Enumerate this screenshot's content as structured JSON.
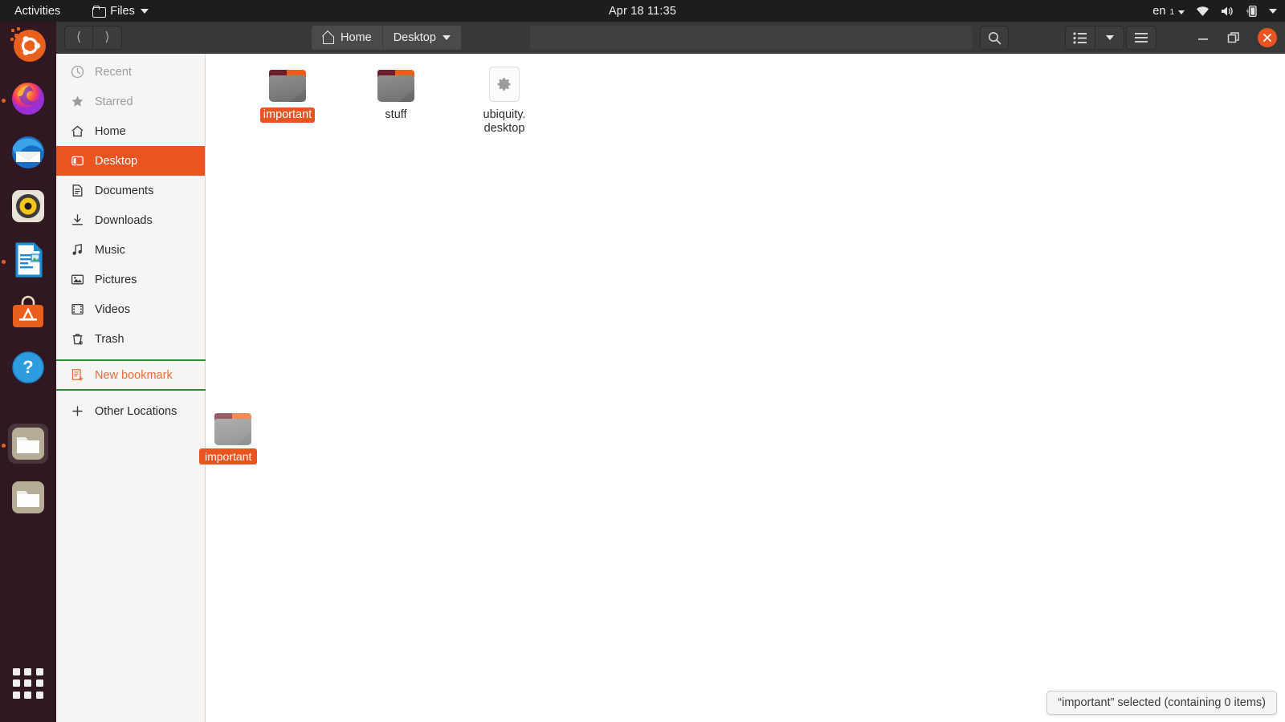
{
  "topbar": {
    "activities": "Activities",
    "app_name": "Files",
    "app_icon": "folder-icon",
    "app_caret_icon": "chevron-down-icon",
    "clock": "Apr 18  11:35",
    "language": "en",
    "language_sub": "1",
    "lang_caret_icon": "chevron-down-icon",
    "wifi_icon": "wifi-icon",
    "volume_icon": "volume-icon",
    "battery_icon": "battery-charging-icon",
    "system_caret_icon": "chevron-down-icon"
  },
  "dock": {
    "items": [
      {
        "name": "ubuntu-logo",
        "label": "Ubuntu",
        "running": false,
        "active": false
      },
      {
        "name": "firefox",
        "label": "Firefox",
        "running": true,
        "active": false
      },
      {
        "name": "thunderbird",
        "label": "Thunderbird Mail",
        "running": false,
        "active": false
      },
      {
        "name": "rhythmbox",
        "label": "Rhythmbox",
        "running": false,
        "active": false
      },
      {
        "name": "libreoffice-writer",
        "label": "LibreOffice Writer",
        "running": true,
        "active": false
      },
      {
        "name": "ubuntu-software",
        "label": "Ubuntu Software",
        "running": false,
        "active": false
      },
      {
        "name": "help",
        "label": "Help",
        "running": false,
        "active": false
      },
      {
        "name": "files",
        "label": "Files",
        "running": true,
        "active": true
      },
      {
        "name": "files-secondary",
        "label": "Files",
        "running": false,
        "active": false
      }
    ],
    "app_grid_label": "Show Applications"
  },
  "headerbar": {
    "back_icon": "chevron-left-icon",
    "forward_icon": "chevron-right-icon",
    "breadcrumbs": [
      {
        "label": "Home",
        "icon": "home-icon",
        "has_caret": false
      },
      {
        "label": "Desktop",
        "icon": "",
        "has_caret": true
      }
    ],
    "search_icon": "search-icon",
    "view_list_icon": "list-view-icon",
    "view_caret_icon": "chevron-down-icon",
    "menu_icon": "hamburger-menu-icon",
    "minimize_icon": "minimize-icon",
    "maximize_icon": "maximize-icon",
    "close_icon": "close-icon"
  },
  "sidebar": {
    "items": [
      {
        "label": "Recent",
        "icon": "clock-icon",
        "state": "dim"
      },
      {
        "label": "Starred",
        "icon": "star-icon",
        "state": "dim"
      },
      {
        "label": "Home",
        "icon": "home-icon",
        "state": "normal"
      },
      {
        "label": "Desktop",
        "icon": "desktop-icon",
        "state": "selected"
      },
      {
        "label": "Documents",
        "icon": "documents-icon",
        "state": "normal"
      },
      {
        "label": "Downloads",
        "icon": "downloads-icon",
        "state": "normal"
      },
      {
        "label": "Music",
        "icon": "music-icon",
        "state": "normal"
      },
      {
        "label": "Pictures",
        "icon": "pictures-icon",
        "state": "normal"
      },
      {
        "label": "Videos",
        "icon": "videos-icon",
        "state": "normal"
      },
      {
        "label": "Trash",
        "icon": "trash-icon",
        "state": "normal"
      },
      {
        "label": "New bookmark",
        "icon": "new-bookmark-icon",
        "state": "bookmark"
      },
      {
        "label": "Other Locations",
        "icon": "plus-icon",
        "state": "normal"
      }
    ]
  },
  "drag": {
    "label": "important",
    "icon": "folder-icon"
  },
  "files": [
    {
      "name": "important",
      "icon": "folder-icon",
      "selected": true
    },
    {
      "name": "stuff",
      "icon": "folder-icon",
      "selected": false
    },
    {
      "name": "ubiquity.\ndesktop",
      "icon": "gear-icon",
      "selected": false
    }
  ],
  "status": {
    "text": "“important” selected  (containing 0 items)"
  },
  "colors": {
    "accent": "#e95420",
    "drop_indicator": "#2e8b34",
    "sidebar_bg": "#f6f5f4",
    "headerbar_bg": "#383838",
    "topbar_bg": "#1d1d1d",
    "dock_bg": "#2c0a14"
  }
}
